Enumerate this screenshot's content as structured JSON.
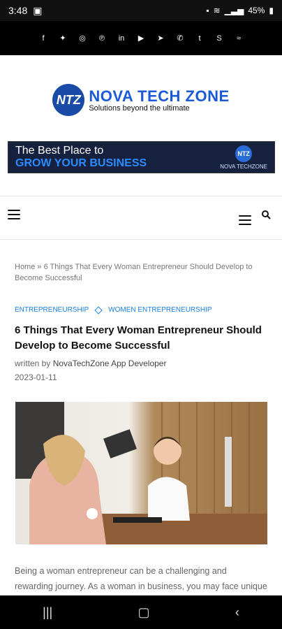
{
  "status": {
    "time": "3:48",
    "battery": "45%"
  },
  "social": [
    "facebook",
    "twitter",
    "instagram",
    "pinterest",
    "linkedin",
    "youtube",
    "telegram",
    "whatsapp",
    "tumblr",
    "skype",
    "rss"
  ],
  "logo": {
    "badge": "NTZ",
    "name": "NOVA TECH ZONE",
    "tagline": "Solutions beyond the ultimate"
  },
  "banner": {
    "line1": "The Best Place to",
    "line2": "GROW YOUR BUSINESS",
    "mini_badge": "NTZ",
    "mini_text": "NOVA TECHZONE"
  },
  "breadcrumb": "Home » 6 Things That Every Woman Entrepreneur Should Develop to Become Successful",
  "categories": [
    "ENTREPRENEURSHIP",
    "WOMEN ENTREPRENEURSHIP"
  ],
  "article": {
    "title": "6 Things That Every Woman Entrepreneur Should Develop to Become Successful",
    "author_prefix": "written by",
    "author": "NovaTechZone App Developer",
    "date": "2023-01-11",
    "paragraph": "Being a woman entrepreneur can be a challenging and rewarding journey. As a woman in business, you may face unique obstacles"
  }
}
